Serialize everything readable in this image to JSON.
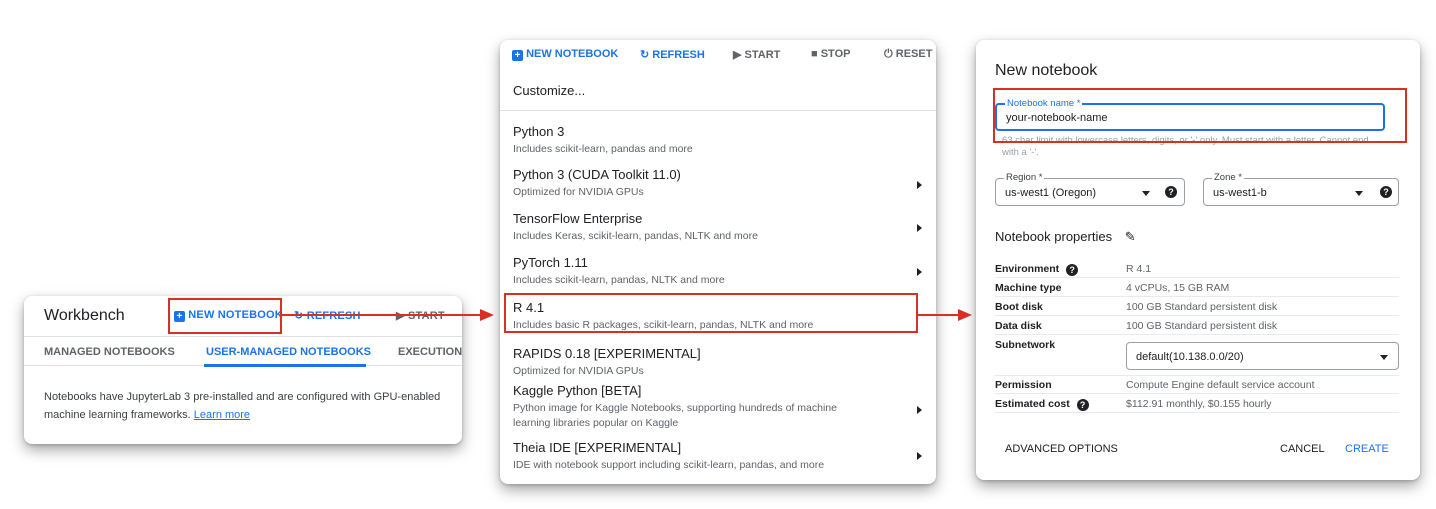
{
  "workbench": {
    "title": "Workbench",
    "new_notebook": "NEW NOTEBOOK",
    "refresh": "REFRESH",
    "start": "START",
    "tabs": [
      "MANAGED NOTEBOOKS",
      "USER-MANAGED NOTEBOOKS",
      "EXECUTIONS"
    ],
    "active_tab": "USER-MANAGED NOTEBOOKS",
    "description": "Notebooks have JupyterLab 3 pre-installed and are configured with GPU-enabled machine learning frameworks.",
    "learn_more": "Learn more"
  },
  "menu": {
    "toolbar": {
      "new_notebook": "NEW NOTEBOOK",
      "refresh": "REFRESH",
      "start": "START",
      "stop": "STOP",
      "reset": "RESET"
    },
    "customize": "Customize...",
    "items": [
      {
        "title": "Python 3",
        "subtitle": "Includes scikit-learn, pandas and more"
      },
      {
        "title": "Python 3 (CUDA Toolkit 11.0)",
        "subtitle": "Optimized for NVIDIA GPUs"
      },
      {
        "title": "TensorFlow Enterprise",
        "subtitle": "Includes Keras, scikit-learn, pandas, NLTK and more"
      },
      {
        "title": "PyTorch 1.11",
        "subtitle": "Includes scikit-learn, pandas, NLTK and more"
      },
      {
        "title": "R 4.1",
        "subtitle": "Includes basic R packages, scikit-learn, pandas, NLTK and more"
      },
      {
        "title": "RAPIDS 0.18 [EXPERIMENTAL]",
        "subtitle": "Optimized for NVIDIA GPUs"
      },
      {
        "title": "Kaggle Python [BETA]",
        "subtitle": "Python image for Kaggle Notebooks, supporting hundreds of machine learning libraries popular on Kaggle"
      },
      {
        "title": "Theia IDE [EXPERIMENTAL]",
        "subtitle": "IDE with notebook support including scikit-learn, pandas, and more"
      }
    ]
  },
  "new_notebook": {
    "heading": "New notebook",
    "name_label": "Notebook name *",
    "name_value": "your-notebook-name",
    "name_hint": "63 char limit with lowercase letters, digits, or '-' only. Must start with a letter. Cannot end with a '-'.",
    "region_label": "Region *",
    "region_value": "us-west1 (Oregon)",
    "zone_label": "Zone *",
    "zone_value": "us-west1-b",
    "properties_heading": "Notebook properties",
    "properties": [
      {
        "key": "Environment",
        "value": "R 4.1"
      },
      {
        "key": "Machine type",
        "value": "4 vCPUs, 15 GB RAM"
      },
      {
        "key": "Boot disk",
        "value": "100 GB Standard persistent disk"
      },
      {
        "key": "Data disk",
        "value": "100 GB Standard persistent disk"
      }
    ],
    "subnetwork_label": "Subnetwork",
    "subnetwork_value": "default(10.138.0.0/20)",
    "permission_label": "Permission",
    "permission_value": "Compute Engine default service account",
    "cost_label": "Estimated cost",
    "cost_value": "$112.91 monthly, $0.155 hourly",
    "advanced_options": "ADVANCED OPTIONS",
    "cancel": "CANCEL",
    "create": "CREATE"
  },
  "colors": {
    "accent": "#1a73e8",
    "highlight": "#d93025"
  }
}
